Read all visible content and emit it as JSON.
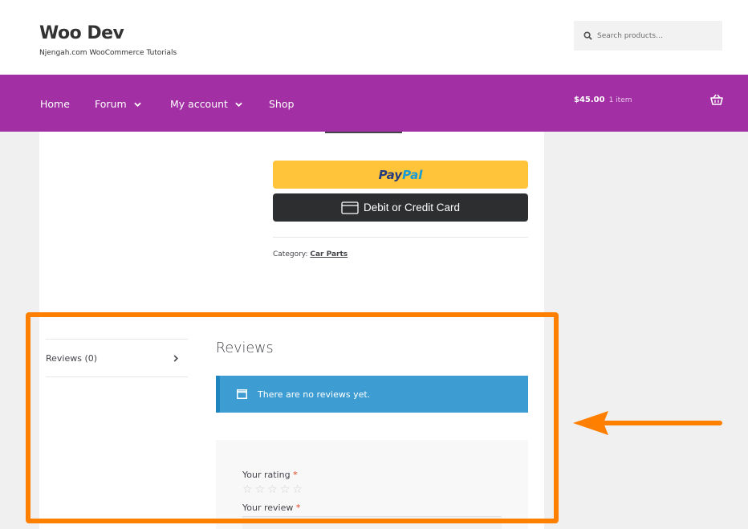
{
  "header": {
    "site_title": "Woo Dev",
    "tagline": "Njengah.com WooCommerce Tutorials",
    "search_placeholder": "Search products…",
    "search_icon": "magnifier-icon"
  },
  "nav": {
    "items": [
      {
        "label": "Home",
        "has_dropdown": false
      },
      {
        "label": "Forum",
        "has_dropdown": true
      },
      {
        "label": "My account",
        "has_dropdown": true
      },
      {
        "label": "Shop",
        "has_dropdown": false
      }
    ],
    "cart_amount": "$45.00",
    "cart_count": "1 item",
    "cart_icon": "basket-icon"
  },
  "payment": {
    "paypal_part1": "Pay",
    "paypal_part2": "Pal",
    "card_label": "Debit or Credit Card",
    "card_icon": "credit-card-icon"
  },
  "product_meta": {
    "category_label": "Category:",
    "category_value": "Car Parts"
  },
  "tabs": {
    "reviews_tab": "Reviews (0)"
  },
  "reviews": {
    "heading": "Reviews",
    "notice": "There are no reviews yet.",
    "notice_icon": "browser-window-icon",
    "rating_label": "Your rating",
    "review_label": "Your review",
    "required_marker": "*",
    "stars": [
      "☆",
      "☆",
      "☆",
      "☆",
      "☆"
    ]
  },
  "colors": {
    "nav_bg": "#a22fa3",
    "paypal_yellow": "#ffc439",
    "card_button": "#2c2e2f",
    "notice_blue": "#3d9cd2",
    "highlight_orange": "#ff8000"
  }
}
